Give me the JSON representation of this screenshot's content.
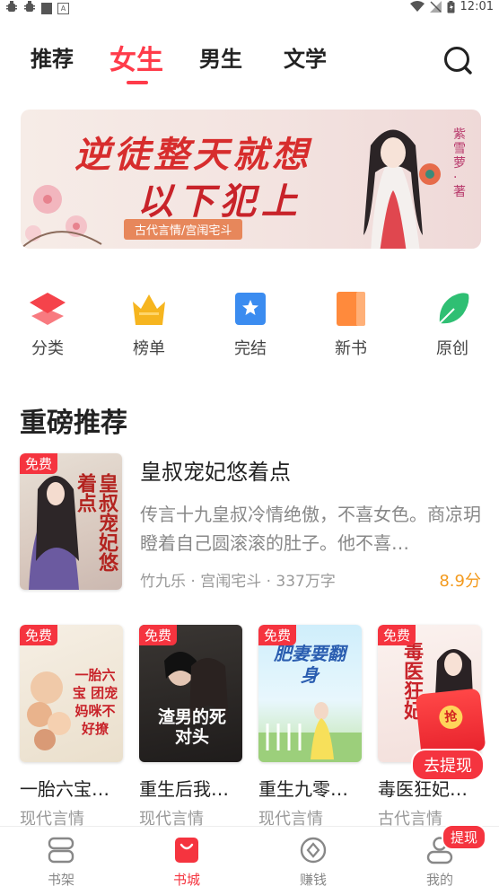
{
  "status_bar": {
    "time": "12:01"
  },
  "tabs": [
    {
      "label": "推荐",
      "active": false
    },
    {
      "label": "女生",
      "active": true
    },
    {
      "label": "男生",
      "active": false
    },
    {
      "label": "文学",
      "active": false
    }
  ],
  "icons": {
    "search": "search-icon"
  },
  "banner": {
    "title_line1": "逆徒整天就想",
    "title_line2": "以下犯上",
    "tag": "古代言情/宫闱宅斗",
    "author": "紫雪萝·著"
  },
  "categories": [
    {
      "label": "分类",
      "icon": "layers-icon",
      "color": "#f5434b"
    },
    {
      "label": "榜单",
      "icon": "crown-icon",
      "color": "#f6b51f"
    },
    {
      "label": "完结",
      "icon": "bookmark-star-icon",
      "color": "#3b8cf0"
    },
    {
      "label": "新书",
      "icon": "book-icon",
      "color": "#ff8a3c"
    },
    {
      "label": "原创",
      "icon": "pen-icon",
      "color": "#2fbf73"
    }
  ],
  "section_title": "重磅推荐",
  "featured": {
    "badge": "免费",
    "title": "皇叔宠妃悠着点",
    "description": "传言十九皇叔冷情绝傲，不喜女色。商凉玥瞪着自己圆滚滚的肚子。他不喜…",
    "meta": "竹九乐 · 宫闱宅斗 · 337万字",
    "score": "8.9分",
    "cover_text": "皇叔宠妃悠着点"
  },
  "books": [
    {
      "badge": "免费",
      "title": "一胎六宝…",
      "genre": "现代言情",
      "cover_text": "一胎六宝 团宠妈咪不好撩"
    },
    {
      "badge": "免费",
      "title": "重生后我…",
      "genre": "现代言情",
      "cover_text": "渣男的死对头"
    },
    {
      "badge": "免费",
      "title": "重生九零…",
      "genre": "现代言情",
      "cover_text": "肥妻要翻身"
    },
    {
      "badge": "免费",
      "title": "毒医狂妃…",
      "genre": "古代言情",
      "cover_text": "毒医狂妃"
    }
  ],
  "floating": {
    "coin": "抢",
    "withdraw": "去提现"
  },
  "bottom_nav": [
    {
      "label": "书架",
      "icon": "bookshelf-icon",
      "active": false
    },
    {
      "label": "书城",
      "icon": "shopping-bag-icon",
      "active": true
    },
    {
      "label": "赚钱",
      "icon": "coin-icon",
      "active": false
    },
    {
      "label": "我的",
      "icon": "user-icon",
      "active": false
    }
  ],
  "nav_badge": "提现",
  "colors": {
    "accent": "#f5343f",
    "score": "#f39a1e"
  }
}
